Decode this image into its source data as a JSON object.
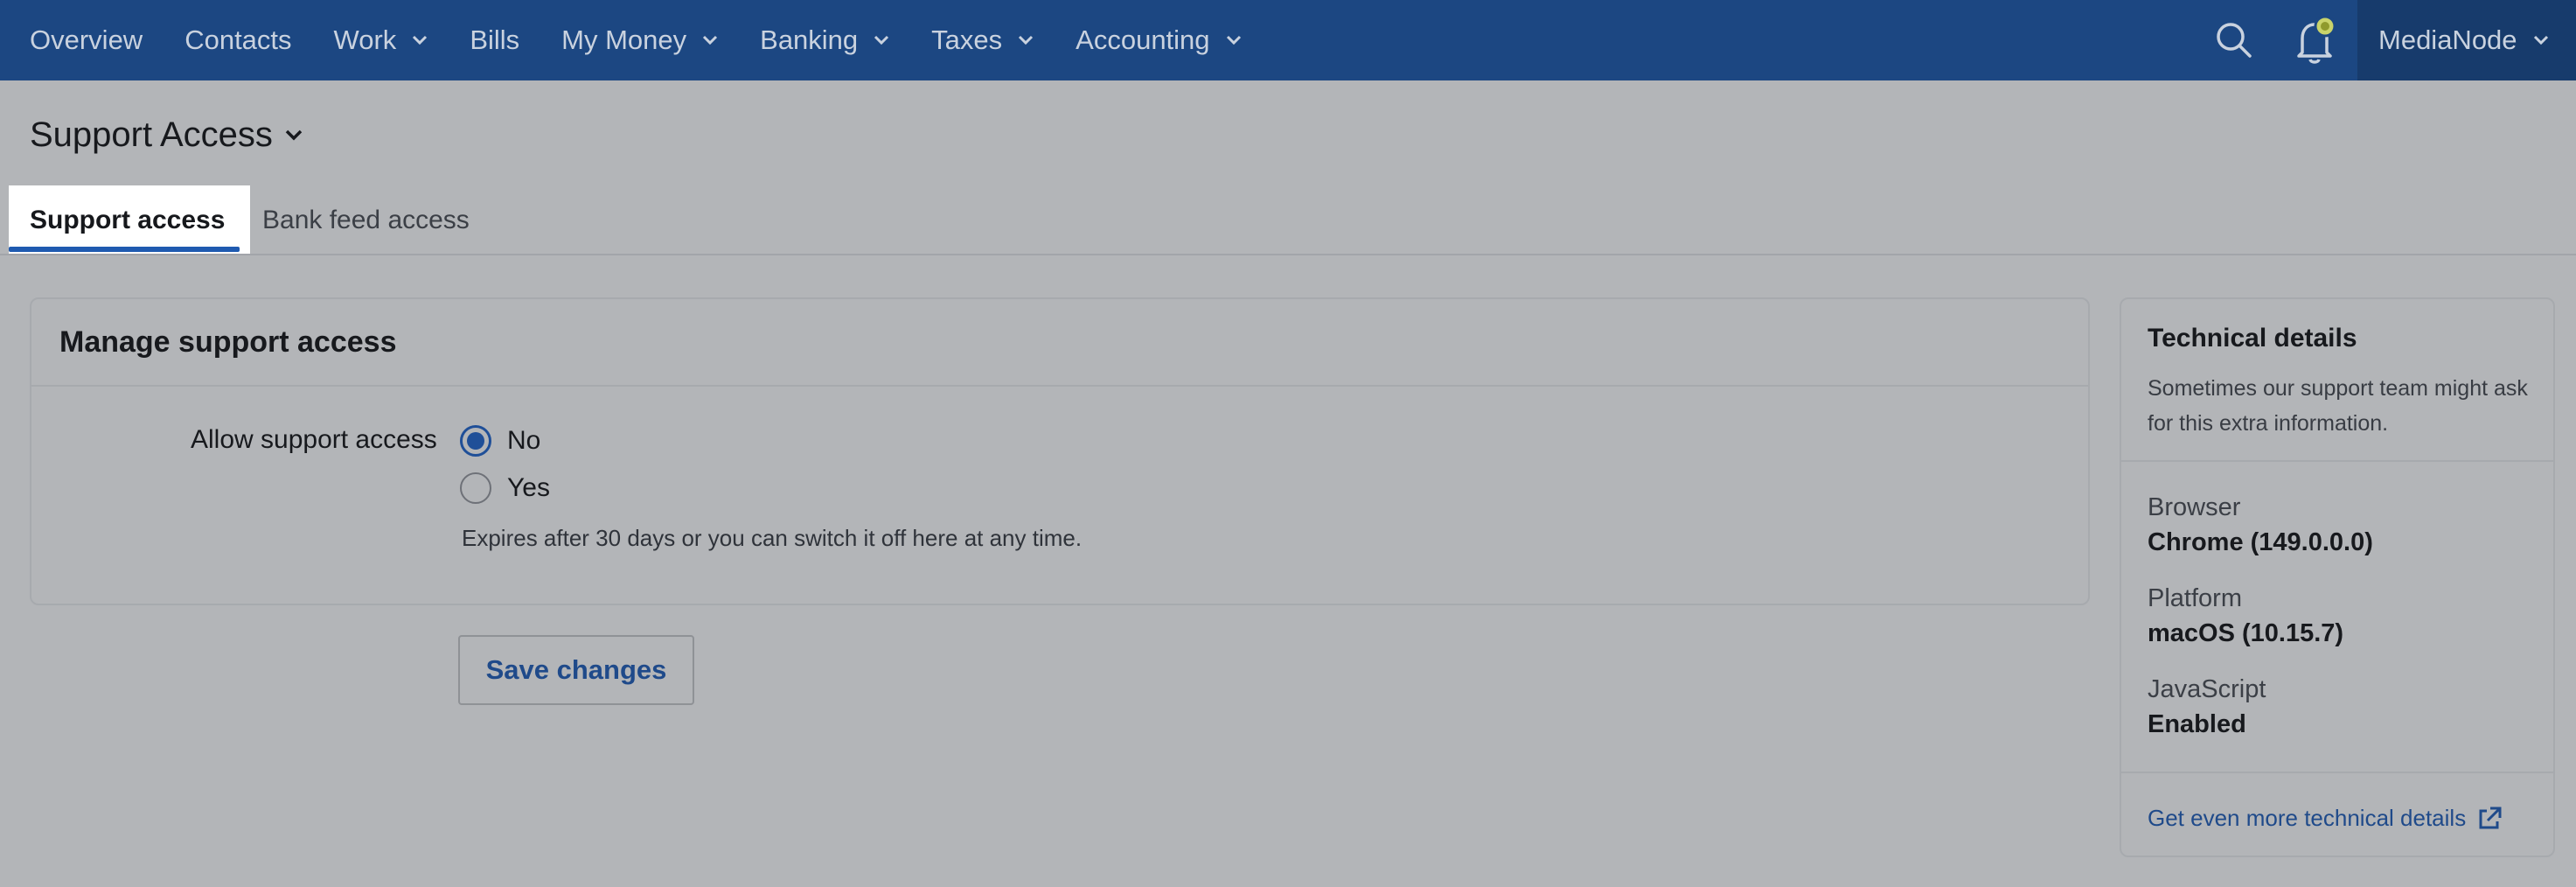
{
  "topnav": {
    "items": [
      {
        "label": "Overview",
        "has_dropdown": false
      },
      {
        "label": "Contacts",
        "has_dropdown": false
      },
      {
        "label": "Work",
        "has_dropdown": true
      },
      {
        "label": "Bills",
        "has_dropdown": false
      },
      {
        "label": "My Money",
        "has_dropdown": true
      },
      {
        "label": "Banking",
        "has_dropdown": true
      },
      {
        "label": "Taxes",
        "has_dropdown": true
      },
      {
        "label": "Accounting",
        "has_dropdown": true
      }
    ],
    "search_icon": "search-icon",
    "notifications_icon": "bell-icon",
    "organization": "MediaNode"
  },
  "page": {
    "title": "Support Access",
    "tabs": [
      {
        "label": "Support access",
        "active": true
      },
      {
        "label": "Bank feed access",
        "active": false
      }
    ]
  },
  "card": {
    "heading": "Manage support access",
    "field_label": "Allow support access",
    "options": [
      {
        "label": "No",
        "checked": true
      },
      {
        "label": "Yes",
        "checked": false
      }
    ],
    "help_text": "Expires after 30 days or you can switch it off here at any time.",
    "save_label": "Save changes"
  },
  "technical": {
    "title": "Technical details",
    "description": "Sometimes our support team might ask for this extra information.",
    "details": [
      {
        "label": "Browser",
        "value": "Chrome (149.0.0.0)"
      },
      {
        "label": "Platform",
        "value": "macOS (10.15.7)"
      },
      {
        "label": "JavaScript",
        "value": "Enabled"
      }
    ],
    "link_label": "Get even more technical details"
  },
  "colors": {
    "nav_background": "#1c4782",
    "accent": "#1f5ab0",
    "link": "#1f4a8a",
    "notification_badge": "#c9d36a"
  }
}
